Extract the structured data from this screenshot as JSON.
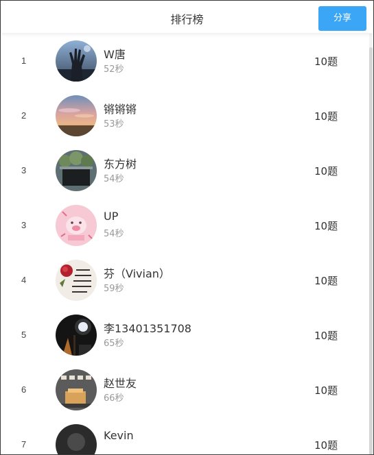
{
  "header": {
    "title": "排行榜",
    "share_label": "分享"
  },
  "rows": [
    {
      "rank": "1",
      "name": "W唐",
      "time": "52秒",
      "score": "10题",
      "avatar": "hand-silhouette-photo"
    },
    {
      "rank": "2",
      "name": "锵锵锵",
      "time": "53秒",
      "score": "10题",
      "avatar": "sunset-sky-photo"
    },
    {
      "rank": "3",
      "name": "东方树",
      "time": "54秒",
      "score": "10题",
      "avatar": "plants-box-photo"
    },
    {
      "rank": "3",
      "name": "UP",
      "time": "54秒",
      "score": "10题",
      "avatar": "pink-cartoon-pig"
    },
    {
      "rank": "4",
      "name": "芬（Vivian）",
      "time": "59秒",
      "score": "10题",
      "avatar": "rose-calligraphy-photo"
    },
    {
      "rank": "5",
      "name": "李13401351708",
      "time": "65秒",
      "score": "10题",
      "avatar": "night-moon-photo"
    },
    {
      "rank": "6",
      "name": "赵世友",
      "time": "66秒",
      "score": "10题",
      "avatar": "flower-moon-calligraphy"
    },
    {
      "rank": "7",
      "name": "Kevin",
      "time": "",
      "score": "10题",
      "avatar": "dark-portrait-photo"
    }
  ],
  "colors": {
    "accent": "#3aa6f5",
    "muted_text": "#999999"
  }
}
